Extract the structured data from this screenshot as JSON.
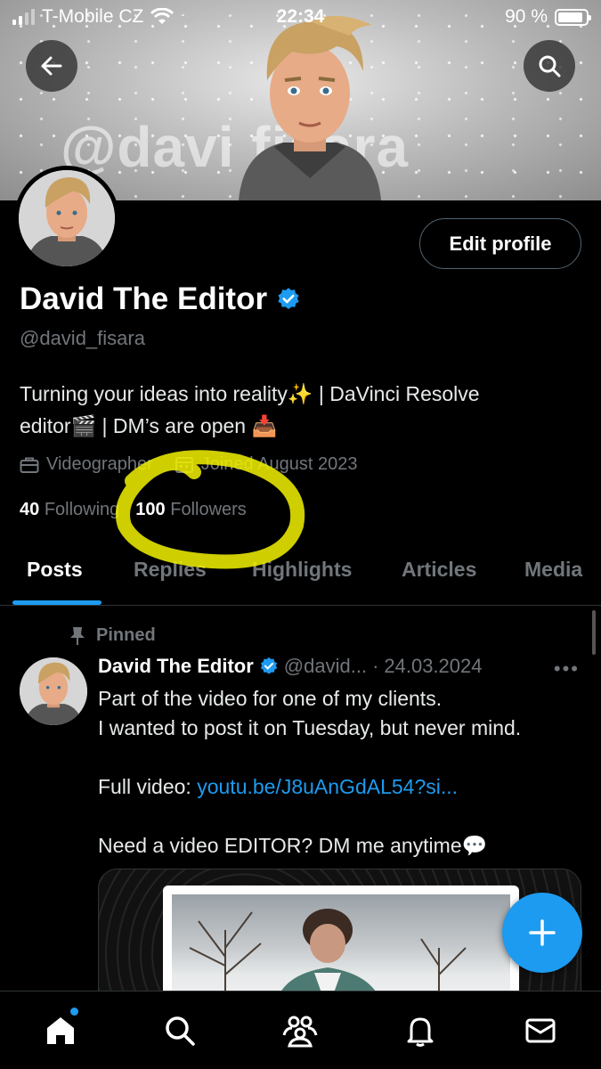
{
  "status_bar": {
    "carrier": "T-Mobile CZ",
    "time": "22:34",
    "battery": "90 %",
    "battery_level": 0.9
  },
  "banner": {
    "text": "@davi  fisara"
  },
  "profile": {
    "edit_label": "Edit profile",
    "name": "David The Editor",
    "handle": "@david_fisara",
    "bio_line1": "Turning your ideas into reality✨  | DaVinci Resolve",
    "bio_line2": "editor🎬 | DM’s are open 📥",
    "category": "Videographer",
    "joined": "Joined August 2023",
    "following_count": "40",
    "following_label": "Following",
    "followers_count": "100",
    "followers_label": "Followers"
  },
  "tabs": [
    {
      "label": "Posts"
    },
    {
      "label": "Replies"
    },
    {
      "label": "Highlights"
    },
    {
      "label": "Articles"
    },
    {
      "label": "Media"
    }
  ],
  "post": {
    "pinned_label": "Pinned",
    "author": "David The Editor",
    "handle": "@david...",
    "separator": "·",
    "date": "24.03.2024",
    "more": "•••",
    "line1": "Part of the video for one of my clients.",
    "line2": "I wanted to post it on Tuesday, but never mind.",
    "full_video_label": "Full video: ",
    "link": "youtu.be/J8uAnGdAL54?si...",
    "line4": "Need a video EDITOR? DM me anytime💬"
  },
  "colors": {
    "accent": "#1d9bf0",
    "highlight": "#f2f200",
    "background": "#000000",
    "muted": "#71767b"
  },
  "icons": {
    "back": "arrow-left-icon",
    "search": "search-icon",
    "verified": "verified-badge-icon",
    "briefcase": "briefcase-icon",
    "calendar": "calendar-icon",
    "pin": "pin-icon",
    "compose": "plus-icon",
    "nav": [
      "home-icon",
      "search-icon",
      "communities-icon",
      "bell-icon",
      "mail-icon"
    ]
  }
}
